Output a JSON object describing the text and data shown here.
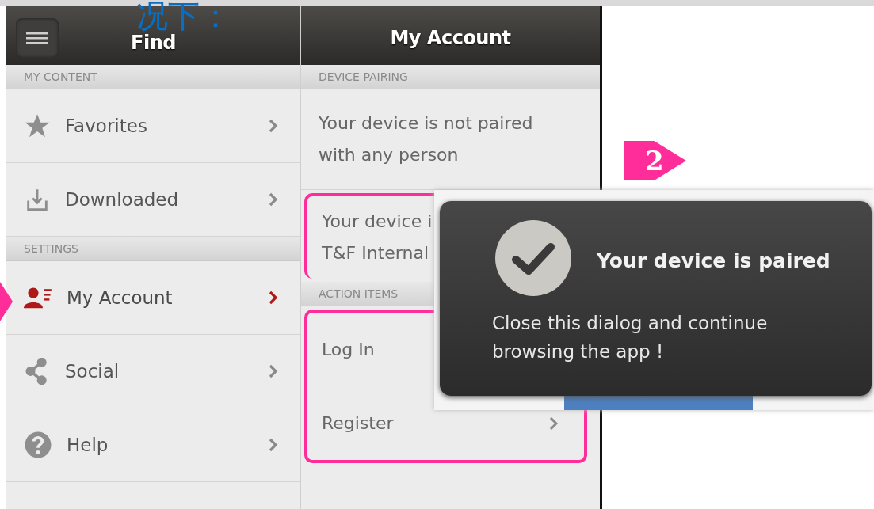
{
  "caption": "况下：",
  "header": {
    "left_title": "Find",
    "right_title": "My Account"
  },
  "sidebar": {
    "sections": [
      {
        "heading": "MY CONTENT",
        "items": [
          {
            "label": "Favorites",
            "selected": false
          },
          {
            "label": "Downloaded",
            "selected": false
          }
        ]
      },
      {
        "heading": "SETTINGS",
        "items": [
          {
            "label": "My Account",
            "selected": true
          },
          {
            "label": "Social",
            "selected": false
          },
          {
            "label": "Help",
            "selected": false
          }
        ]
      }
    ]
  },
  "account": {
    "sections": [
      {
        "heading": "DEVICE PAIRING",
        "highlighted": false,
        "rows": [
          {
            "lines": [
              "Your device is not paired",
              "with any person"
            ],
            "chevron": false,
            "highlighted": false
          },
          {
            "lines": [
              "Your device i",
              "T&F Internal"
            ],
            "chevron": false,
            "highlighted": true
          }
        ]
      },
      {
        "heading": "ACTION ITEMS",
        "highlighted": true,
        "rows": [
          {
            "lines": [
              "Log In"
            ],
            "highlighted": false
          },
          {
            "lines": [
              "Register"
            ],
            "chevron": true,
            "highlighted": false
          }
        ]
      }
    ]
  },
  "dialog": {
    "title": "Your device is paired",
    "message": "Close this dialog and continue browsing the app !"
  },
  "step_marker": "2"
}
